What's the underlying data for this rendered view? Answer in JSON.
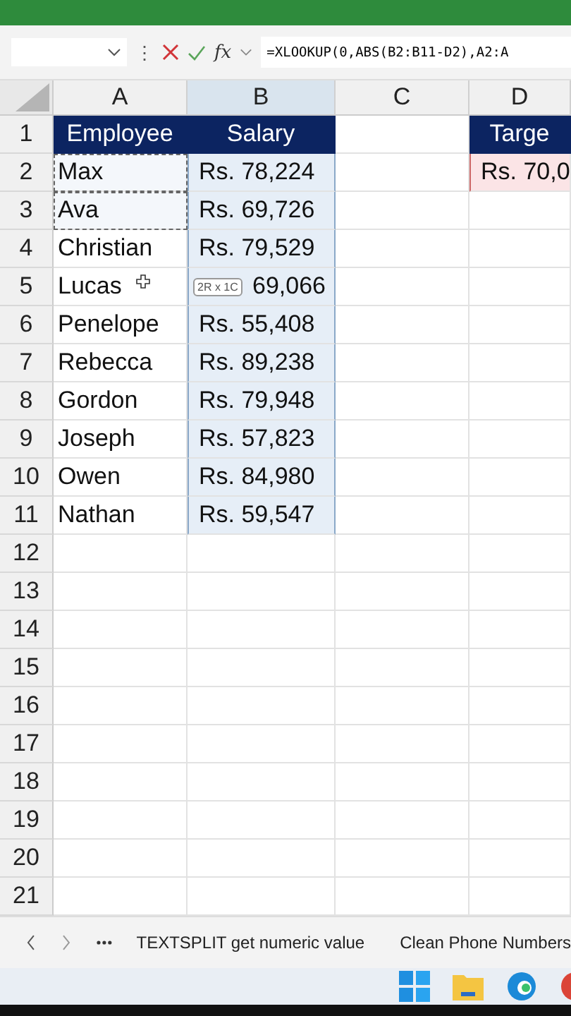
{
  "formula_bar": {
    "separator": "⋮",
    "function_label": "fx",
    "formula": "=XLOOKUP(0,ABS(B2:B11-D2),A2:A"
  },
  "columns": [
    "A",
    "B",
    "C",
    "D"
  ],
  "rows": [
    {
      "number": "1",
      "cells": [
        {
          "kind": "header",
          "text": "Employee"
        },
        {
          "kind": "header",
          "text": "Salary"
        },
        {
          "kind": "empty"
        },
        {
          "kind": "header",
          "text": "Targe"
        }
      ]
    },
    {
      "number": "2",
      "cells": [
        {
          "kind": "copied",
          "text": "Max"
        },
        {
          "kind": "selected",
          "text": "Rs. 78,224"
        },
        {
          "kind": "empty"
        },
        {
          "kind": "target",
          "text": "Rs. 70,0"
        }
      ]
    },
    {
      "number": "3",
      "cells": [
        {
          "kind": "copied",
          "text": "Ava"
        },
        {
          "kind": "selected",
          "text": "Rs. 69,726"
        },
        {
          "kind": "empty"
        },
        {
          "kind": "empty"
        }
      ]
    },
    {
      "number": "4",
      "cells": [
        {
          "kind": "plain",
          "text": "Christian"
        },
        {
          "kind": "selected",
          "text": "Rs. 79,529"
        },
        {
          "kind": "empty"
        },
        {
          "kind": "empty"
        }
      ]
    },
    {
      "number": "5",
      "cells": [
        {
          "kind": "plain",
          "text": "Lucas",
          "cursor": true
        },
        {
          "kind": "selected",
          "text": "69,066",
          "tooltip": "2R x 1C"
        },
        {
          "kind": "empty"
        },
        {
          "kind": "empty"
        }
      ]
    },
    {
      "number": "6",
      "cells": [
        {
          "kind": "plain",
          "text": "Penelope"
        },
        {
          "kind": "selected",
          "text": "Rs. 55,408"
        },
        {
          "kind": "empty"
        },
        {
          "kind": "empty"
        }
      ]
    },
    {
      "number": "7",
      "cells": [
        {
          "kind": "plain",
          "text": "Rebecca"
        },
        {
          "kind": "selected",
          "text": "Rs. 89,238"
        },
        {
          "kind": "empty"
        },
        {
          "kind": "empty"
        }
      ]
    },
    {
      "number": "8",
      "cells": [
        {
          "kind": "plain",
          "text": "Gordon"
        },
        {
          "kind": "selected",
          "text": "Rs. 79,948"
        },
        {
          "kind": "empty"
        },
        {
          "kind": "empty"
        }
      ]
    },
    {
      "number": "9",
      "cells": [
        {
          "kind": "plain",
          "text": "Joseph"
        },
        {
          "kind": "selected",
          "text": "Rs. 57,823"
        },
        {
          "kind": "empty"
        },
        {
          "kind": "empty"
        }
      ]
    },
    {
      "number": "10",
      "cells": [
        {
          "kind": "plain",
          "text": "Owen"
        },
        {
          "kind": "selected",
          "text": "Rs. 84,980"
        },
        {
          "kind": "empty"
        },
        {
          "kind": "empty"
        }
      ]
    },
    {
      "number": "11",
      "cells": [
        {
          "kind": "plain",
          "text": "Nathan"
        },
        {
          "kind": "selected",
          "text": "Rs. 59,547"
        },
        {
          "kind": "empty"
        },
        {
          "kind": "empty"
        }
      ]
    },
    {
      "number": "12"
    },
    {
      "number": "13"
    },
    {
      "number": "14"
    },
    {
      "number": "15"
    },
    {
      "number": "16"
    },
    {
      "number": "17"
    },
    {
      "number": "18"
    },
    {
      "number": "19"
    },
    {
      "number": "20"
    },
    {
      "number": "21"
    }
  ],
  "sheet_tabs": [
    "TEXTSPLIT get numeric value",
    "Clean Phone Numbers"
  ]
}
